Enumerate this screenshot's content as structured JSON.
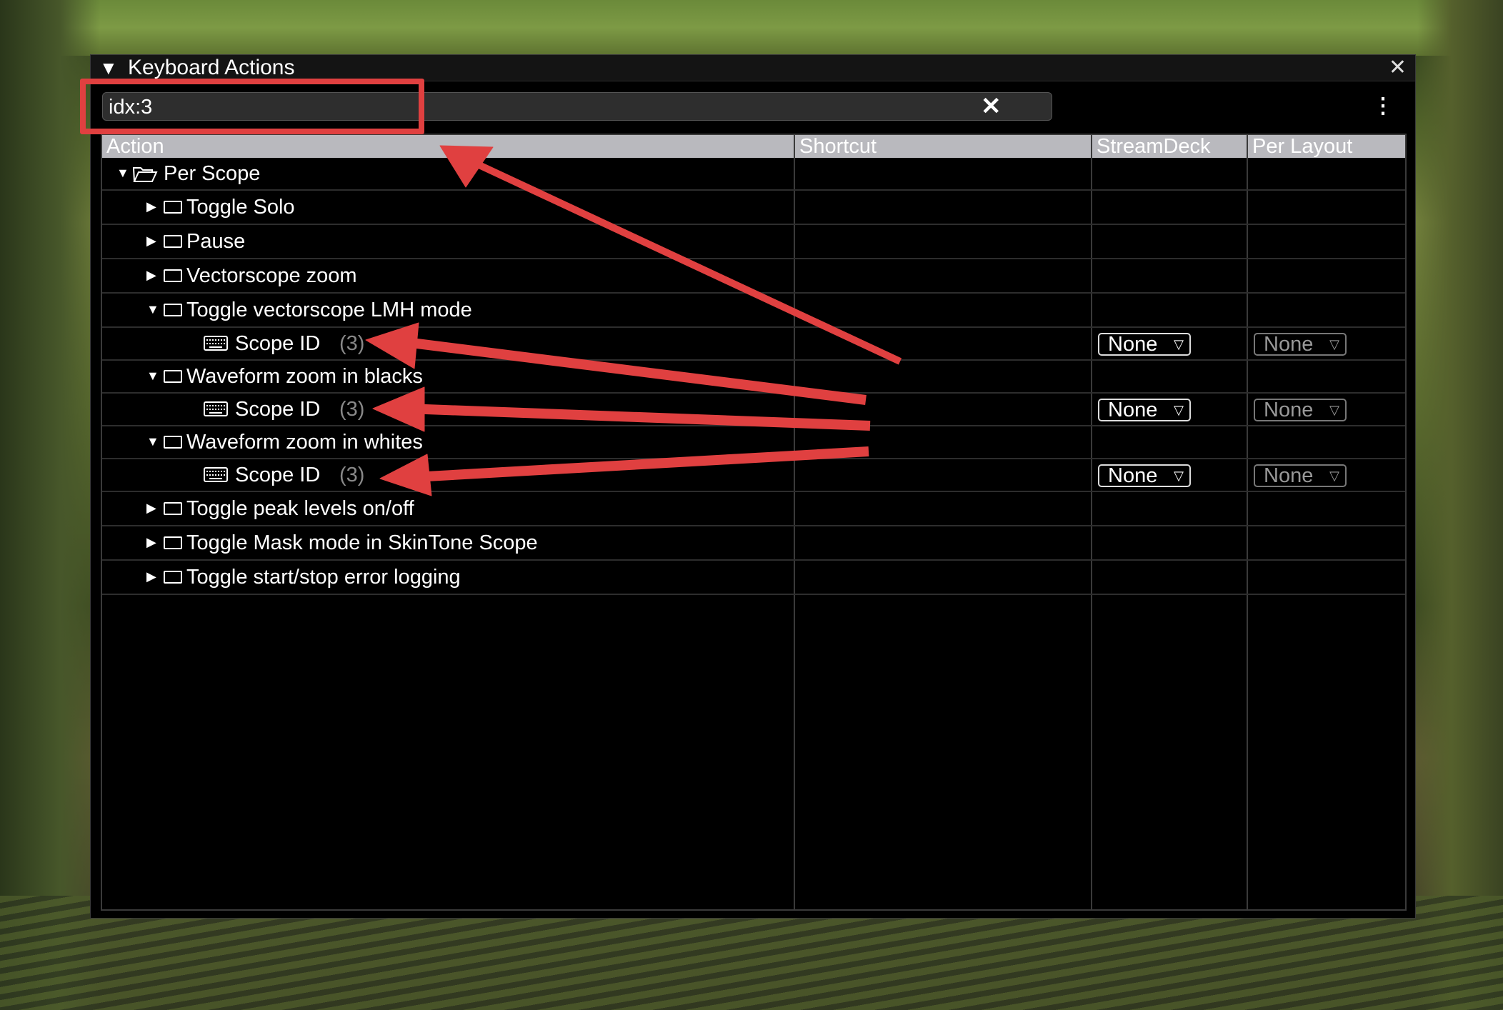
{
  "window": {
    "title": "Keyboard Actions"
  },
  "search": {
    "value": "idx:3"
  },
  "columns": [
    "Action",
    "Shortcut",
    "StreamDeck",
    "Per Layout"
  ],
  "rows": [
    {
      "label": "Per Scope",
      "icon": "folder-open-icon",
      "expander": "expanded",
      "level": 0
    },
    {
      "label": "Toggle Solo",
      "icon": "window-icon",
      "expander": "collapsed",
      "level": 1
    },
    {
      "label": "Pause",
      "icon": "window-icon",
      "expander": "collapsed",
      "level": 1
    },
    {
      "label": "Vectorscope zoom",
      "icon": "window-icon",
      "expander": "collapsed",
      "level": 1
    },
    {
      "label": "Toggle vectorscope LMH mode",
      "icon": "window-icon",
      "expander": "expanded",
      "level": 1
    },
    {
      "label": "Scope ID",
      "count": "(3)",
      "icon": "keyboard-icon",
      "level": 2,
      "streamdeck": "None",
      "per_layout": "None"
    },
    {
      "label": "Waveform zoom in blacks",
      "icon": "window-icon",
      "expander": "expanded",
      "level": 1
    },
    {
      "label": "Scope ID",
      "count": "(3)",
      "icon": "keyboard-icon",
      "level": 2,
      "streamdeck": "None",
      "per_layout": "None"
    },
    {
      "label": "Waveform zoom in whites",
      "icon": "window-icon",
      "expander": "expanded",
      "level": 1
    },
    {
      "label": "Scope ID",
      "count": "(3)",
      "icon": "keyboard-icon",
      "level": 2,
      "streamdeck": "None",
      "per_layout": "None"
    },
    {
      "label": "Toggle peak levels on/off",
      "icon": "window-icon",
      "expander": "collapsed",
      "level": 1
    },
    {
      "label": "Toggle Mask mode in SkinTone Scope",
      "icon": "window-icon",
      "expander": "collapsed",
      "level": 1
    },
    {
      "label": "Toggle start/stop error logging",
      "icon": "window-icon",
      "expander": "collapsed",
      "level": 1
    }
  ],
  "colors": {
    "annotation": "#e04040",
    "header": "#b9b9be",
    "background": "#000000"
  }
}
